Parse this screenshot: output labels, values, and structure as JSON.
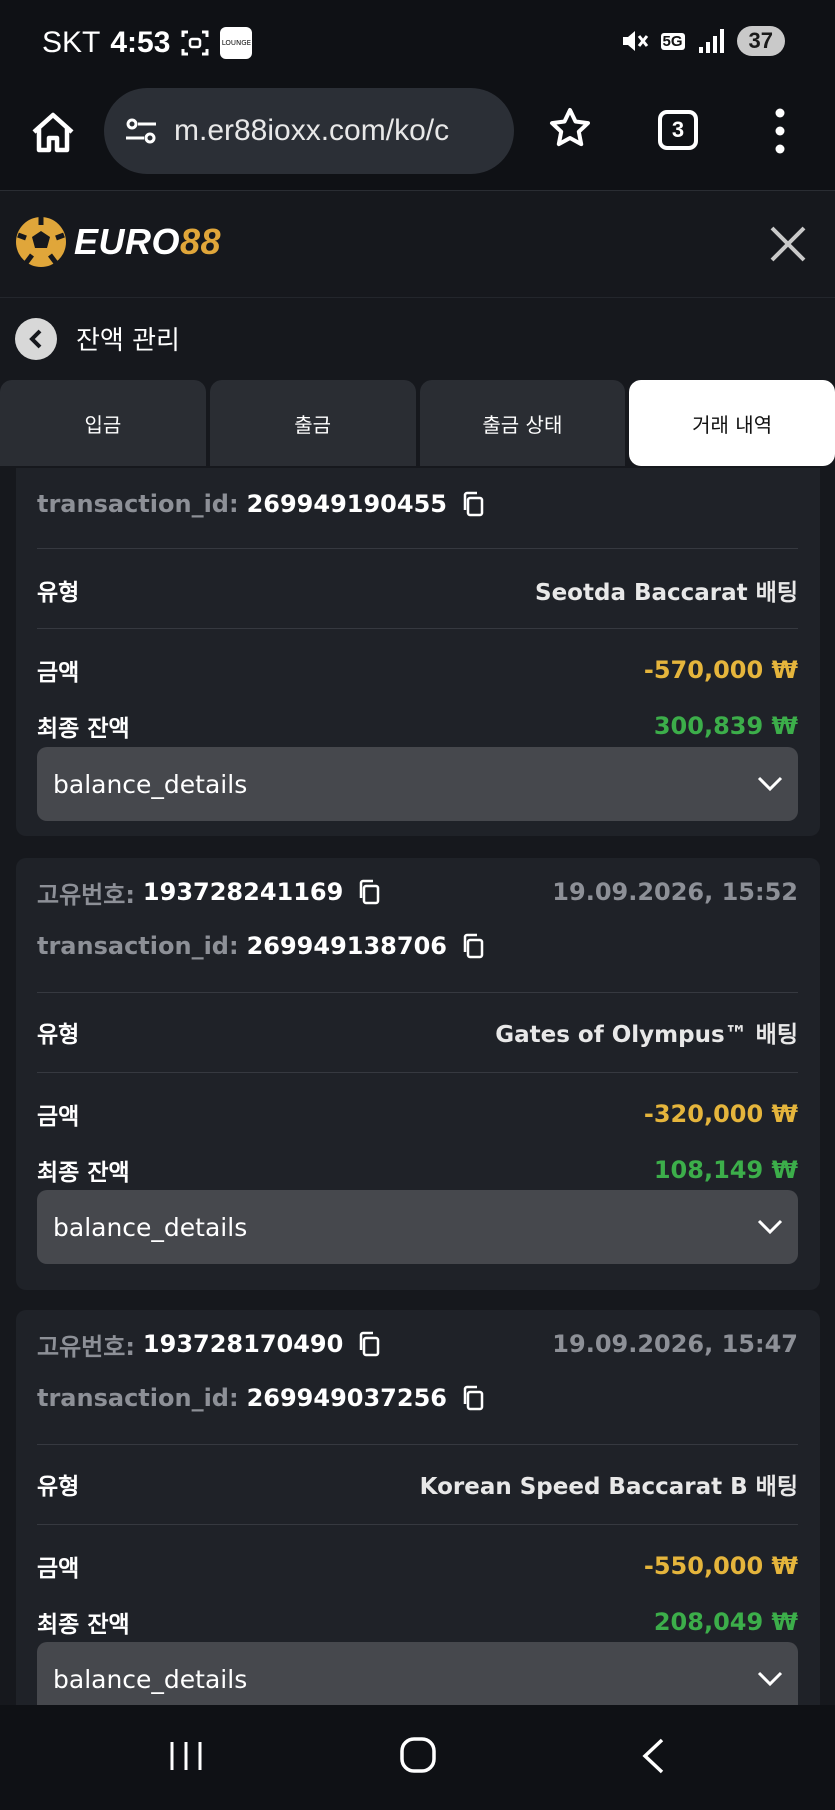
{
  "status_bar": {
    "carrier": "SKT",
    "time": "4:53",
    "lounge_badge": "LOUNGE",
    "network": "5G",
    "battery": "37"
  },
  "browser": {
    "url": "m.er88ioxx.com/ko/c",
    "tab_count": "3"
  },
  "site": {
    "logo_word": "EURO",
    "logo_num": "88"
  },
  "page": {
    "title": "잔액 관리"
  },
  "tabs": [
    {
      "label": "입금",
      "active": false
    },
    {
      "label": "출금",
      "active": false
    },
    {
      "label": "출금 상태",
      "active": false
    },
    {
      "label": "거래 내역",
      "active": true
    }
  ],
  "labels": {
    "unique_no": "고유번호:",
    "transaction_id": "transaction_id:",
    "type": "유형",
    "amount": "금액",
    "final_balance": "최종 잔액",
    "balance_details": "balance_details"
  },
  "transactions": [
    {
      "unique_no": "",
      "datetime": "",
      "transaction_id": "269949190455",
      "type": "Seotda Baccarat 배팅",
      "amount": "-570,000 ₩",
      "final_balance": "300,839 ₩"
    },
    {
      "unique_no": "193728241169",
      "datetime": "19.09.2026, 15:52",
      "transaction_id": "269949138706",
      "type": "Gates of Olympus™ 배팅",
      "amount": "-320,000 ₩",
      "final_balance": "108,149 ₩"
    },
    {
      "unique_no": "193728170490",
      "datetime": "19.09.2026, 15:47",
      "transaction_id": "269949037256",
      "type": "Korean Speed Baccarat B 배팅",
      "amount": "-550,000 ₩",
      "final_balance": "208,049 ₩"
    }
  ],
  "colors": {
    "negative": "#e5b53c",
    "positive": "#3cae4a",
    "brand_gold": "#e0a63a"
  }
}
